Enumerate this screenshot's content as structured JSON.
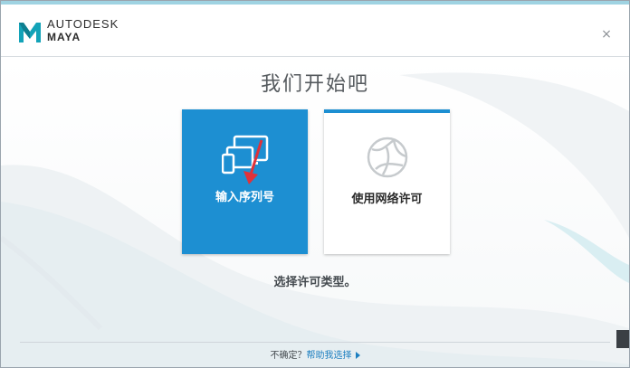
{
  "window": {
    "brand": "AUTODESK",
    "product": "MAYA",
    "close_glyph": "×"
  },
  "main": {
    "title": "我们开始吧",
    "subtitle": "选择许可类型。",
    "cards": [
      {
        "label": "输入序列号",
        "icon": "devices-icon"
      },
      {
        "label": "使用网络许可",
        "icon": "network-globe-icon"
      }
    ]
  },
  "footer": {
    "question": "不确定？",
    "help_link": "帮助我选择"
  },
  "colors": {
    "accent": "#1d8fd2",
    "link": "#1d7fc0"
  }
}
